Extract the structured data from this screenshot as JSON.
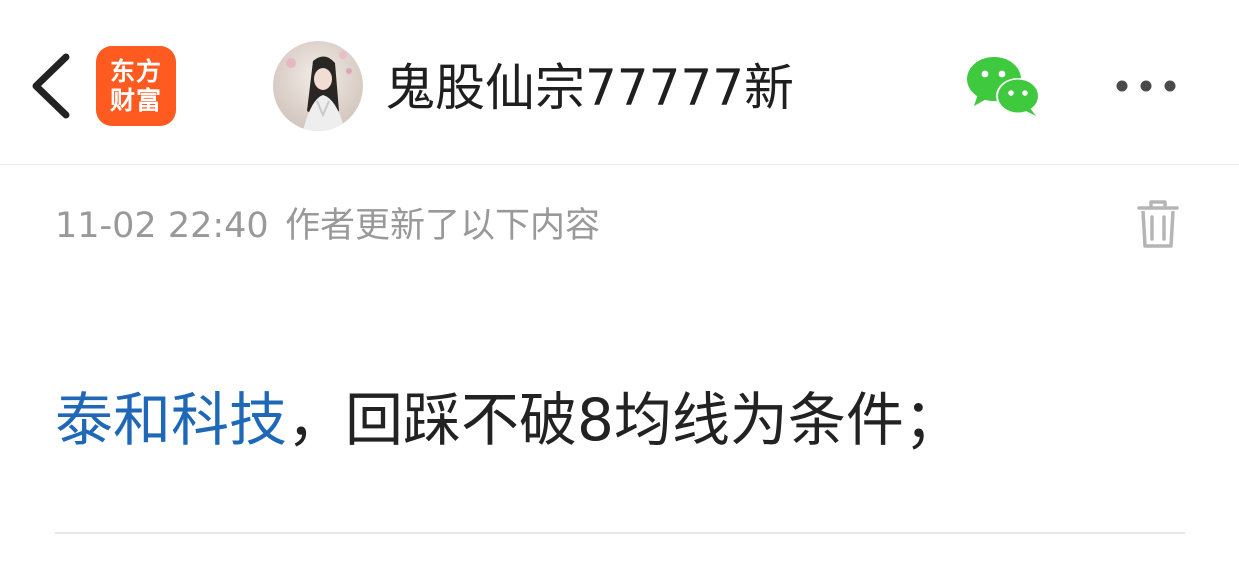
{
  "header": {
    "app_logo": {
      "line1": "东方",
      "line2": "财富",
      "color": "#ff5a1f"
    },
    "author_name": "鬼股仙宗77777新",
    "icons": {
      "back": "chevron-left-icon",
      "share": "wechat-icon",
      "more": "more-horizontal-icon"
    }
  },
  "update": {
    "timestamp": "11-02 22:40",
    "label": "作者更新了以下内容",
    "delete_icon": "trash-icon"
  },
  "content": {
    "stock_name": "泰和科技",
    "text": "，回踩不破8均线为条件；"
  },
  "colors": {
    "link": "#1f68b8",
    "meta": "#999999",
    "wechat": "#3ec93e"
  }
}
